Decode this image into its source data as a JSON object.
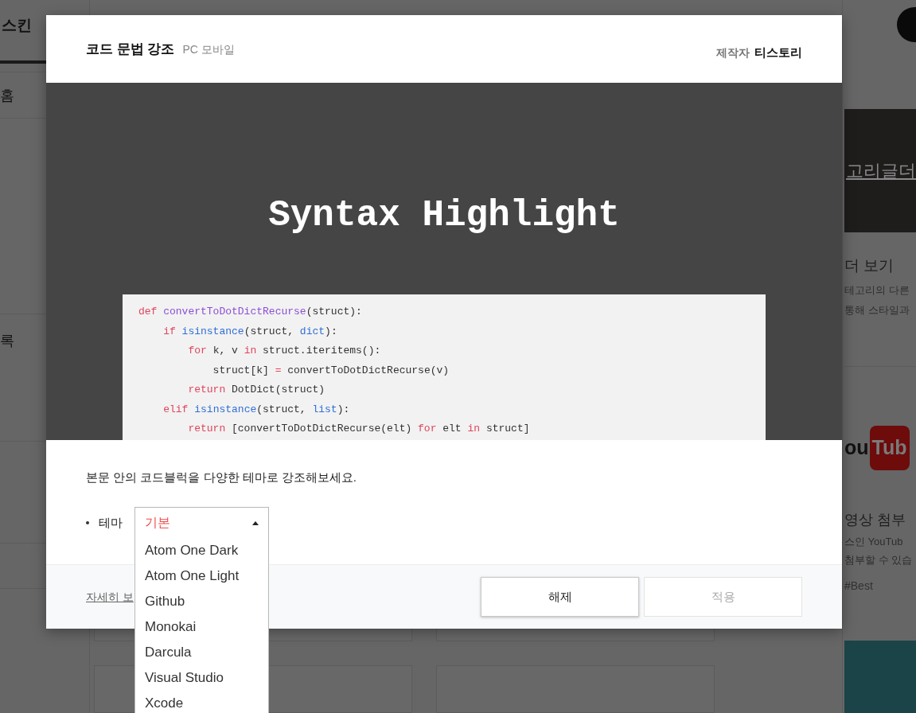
{
  "background": {
    "header_tab": "스킨",
    "sidebar_items": [
      {
        "label": "홈"
      },
      {
        "label": "록"
      }
    ],
    "right_cards": [
      {
        "kind": "image_card",
        "banner_text": "고리글더",
        "title": "더 보기",
        "lines": [
          "테고리의 다른",
          "통해 스타일과"
        ]
      },
      {
        "kind": "video_card",
        "logo_text": [
          "ou",
          "Tub"
        ],
        "title": "영상 첨부",
        "lines": [
          "스인 YouTub",
          "첨부할 수 있습"
        ],
        "tags": [
          "#Best"
        ]
      }
    ]
  },
  "modal": {
    "title": "코드 문법 강조",
    "platforms": "PC 모바일",
    "author_label": "제작자",
    "author": "티스토리",
    "preview": {
      "heading": "Syntax Highlight",
      "code_lines": [
        [
          {
            "kind": "keyword",
            "text": "def"
          },
          {
            "kind": "function",
            "text": " convertToDotDictRecurse"
          },
          {
            "kind": "plain",
            "text": "(struct):"
          }
        ],
        [
          {
            "kind": "keyword",
            "text": "    if"
          },
          {
            "kind": "builtin",
            "text": " isinstance"
          },
          {
            "kind": "plain",
            "text": "(struct, "
          },
          {
            "kind": "builtin",
            "text": "dict"
          },
          {
            "kind": "plain",
            "text": "):"
          }
        ],
        [
          {
            "kind": "keyword",
            "text": "        for"
          },
          {
            "kind": "plain",
            "text": " k, v "
          },
          {
            "kind": "keyword",
            "text": "in"
          },
          {
            "kind": "plain",
            "text": " struct.iteritems():"
          }
        ],
        [
          {
            "kind": "plain",
            "text": "            struct[k] "
          },
          {
            "kind": "keyword",
            "text": "="
          },
          {
            "kind": "plain",
            "text": " convertToDotDictRecurse(v)"
          }
        ],
        [
          {
            "kind": "keyword",
            "text": "        return"
          },
          {
            "kind": "plain",
            "text": " DotDict(struct)"
          }
        ],
        [
          {
            "kind": "keyword",
            "text": "    elif"
          },
          {
            "kind": "builtin",
            "text": " isinstance"
          },
          {
            "kind": "plain",
            "text": "(struct, "
          },
          {
            "kind": "builtin",
            "text": "list"
          },
          {
            "kind": "plain",
            "text": "):"
          }
        ],
        [
          {
            "kind": "keyword",
            "text": "        return"
          },
          {
            "kind": "plain",
            "text": " [convertToDotDictRecurse(elt) "
          },
          {
            "kind": "keyword",
            "text": "for"
          },
          {
            "kind": "plain",
            "text": " elt "
          },
          {
            "kind": "keyword",
            "text": "in"
          },
          {
            "kind": "plain",
            "text": " struct]"
          }
        ]
      ]
    },
    "description": "본문 안의 코드블럭을 다양한 테마로 강조해보세요.",
    "theme_select": {
      "label": "테마",
      "value": "기본",
      "expanded": true,
      "options": [
        {
          "label": "Atom One Dark",
          "selected": false
        },
        {
          "label": "Atom One Light",
          "selected": false
        },
        {
          "label": "Github",
          "selected": false
        },
        {
          "label": "Monokai",
          "selected": false
        },
        {
          "label": "Darcula",
          "selected": false
        },
        {
          "label": "Visual Studio",
          "selected": false
        },
        {
          "label": "Xcode",
          "selected": false
        }
      ]
    },
    "details_link": "자세히 보",
    "buttons": [
      {
        "label": "해제",
        "disabled": false
      },
      {
        "label": "적용",
        "disabled": true
      }
    ]
  }
}
